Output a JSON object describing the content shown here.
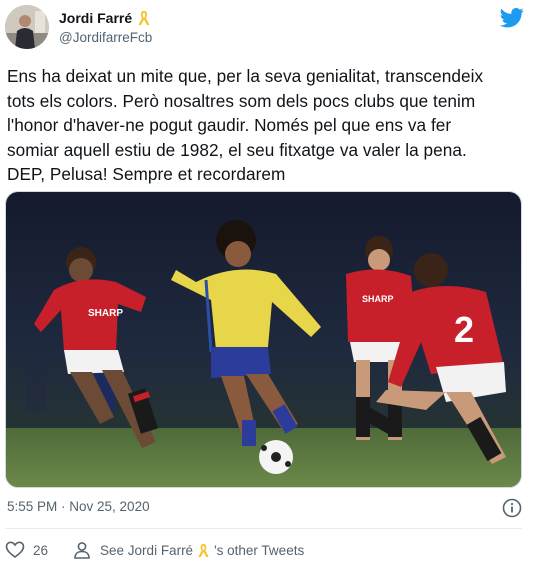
{
  "author": {
    "name": "Jordi Farré",
    "handle": "@JordifarreFcb"
  },
  "tweet": {
    "text_lines": [
      "Ens ha deixat un mite que, per la seva genialitat, transcendeix",
      "tots els colors. Però nosaltres som dels pocs clubs que tenim",
      "l'honor d'haver-ne pogut gaudir. Només pel que ens va fer",
      "somiar aquell estiu de 1982, el seu fitxatge va valer la pena.",
      "DEP, Pelusa! Sempre et recordarem"
    ],
    "photo_text": {
      "sponsor_left": "SHARP",
      "sponsor_right": "SHARP",
      "shirt_number": "2"
    },
    "timestamp": "5:55 PM · Nov 25, 2020"
  },
  "footer": {
    "like_count": "26",
    "see_prefix": "See Jordi Farré",
    "see_suffix": "'s other Tweets"
  },
  "colors": {
    "twitter_blue": "#1d9bf0",
    "ribbon_yellow": "#f4c430",
    "muted": "#536471"
  },
  "icons": {
    "brand": "twitter-bird-icon",
    "verified_like": "yellow-ribbon-icon",
    "info": "info-icon",
    "like": "heart-icon",
    "profile": "person-icon"
  }
}
